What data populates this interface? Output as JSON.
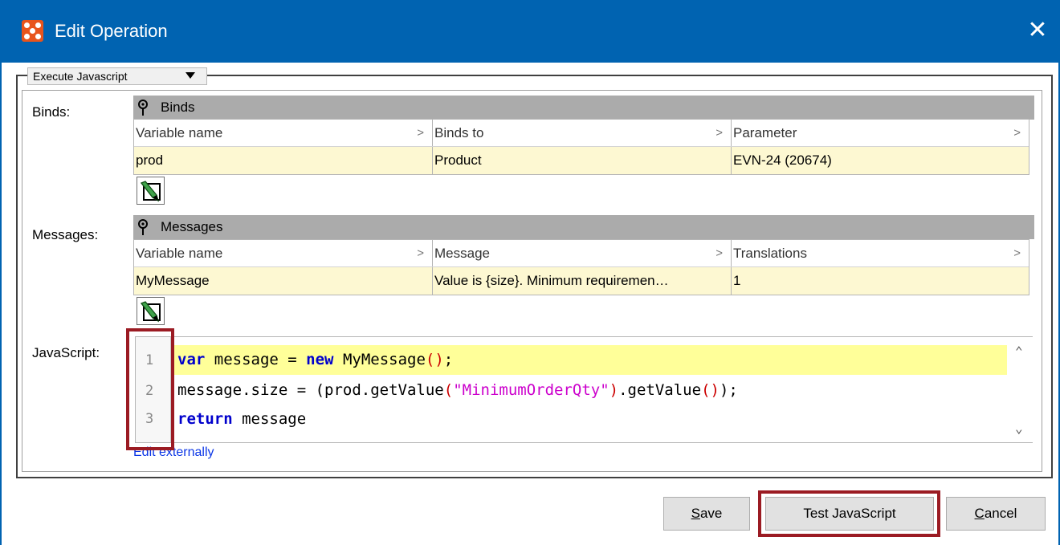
{
  "window": {
    "title": "Edit Operation",
    "close_label": "✕"
  },
  "operation_type": {
    "selected": "Execute Javascript"
  },
  "binds": {
    "field_label": "Binds:",
    "header_label": "Binds",
    "columns": [
      "Variable name",
      "Binds to",
      "Parameter"
    ],
    "rows": [
      [
        "prod",
        "Product",
        "EVN-24 (20674)"
      ]
    ]
  },
  "messages": {
    "field_label": "Messages:",
    "header_label": "Messages",
    "columns": [
      "Variable name",
      "Message",
      "Translations"
    ],
    "rows": [
      [
        "MyMessage",
        "Value is {size}. Minimum requiremen…",
        "1"
      ]
    ]
  },
  "javascript": {
    "field_label": "JavaScript:",
    "line_numbers": [
      "1",
      "2",
      "3"
    ],
    "lines": [
      "var message = new MyMessage();",
      "message.size = (prod.getValue(\"MinimumOrderQty\").getValue());",
      "return message"
    ],
    "edit_link": "Edit externally"
  },
  "buttons": {
    "save_prefix": "",
    "save_mnemonic": "S",
    "save_rest": "ave",
    "test": "Test JavaScript",
    "cancel_mnemonic": "C",
    "cancel_rest": "ancel"
  },
  "colors": {
    "titlebar": "#0063b1",
    "highlight_box": "#9b1b23",
    "row_highlight": "#fdf8d2",
    "code_current_line": "#ffff99",
    "link": "#0b36e6"
  }
}
